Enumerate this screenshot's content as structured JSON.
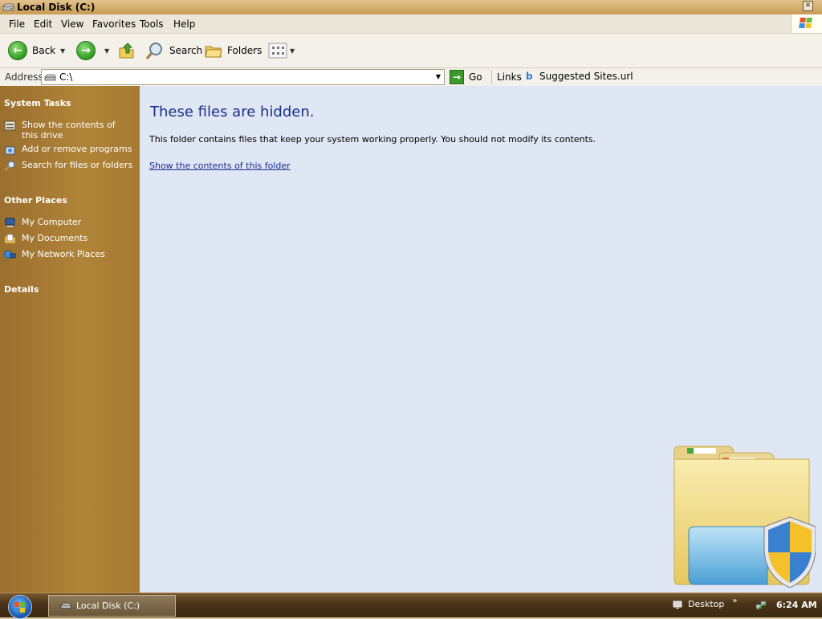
{
  "window": {
    "title": "Local Disk (C:)"
  },
  "menu": {
    "items": [
      "File",
      "Edit",
      "View",
      "Favorites",
      "Tools",
      "Help"
    ]
  },
  "toolbar": {
    "back": "Back",
    "search": "Search",
    "folders": "Folders"
  },
  "address": {
    "label": "Address",
    "value": "C:\\",
    "go": "Go",
    "links": "Links",
    "suggested": "Suggested Sites.url"
  },
  "sidebar": {
    "system_tasks": {
      "title": "System Tasks",
      "items": [
        "Show the contents of this drive",
        "Add or remove programs",
        "Search for files or folders"
      ]
    },
    "other_places": {
      "title": "Other Places",
      "items": [
        "My Computer",
        "My Documents",
        "My Network Places"
      ]
    },
    "details": {
      "title": "Details"
    }
  },
  "content": {
    "heading": "These files are hidden.",
    "description": "This folder contains files that keep your system working properly. You should not modify its contents.",
    "link": "Show the contents of this folder"
  },
  "taskbar": {
    "task": "Local Disk (C:)",
    "desktop": "Desktop",
    "time": "6:24 AM"
  },
  "colors": {
    "sidebar": "#a57a32",
    "content_bg": "#dfe6f4",
    "heading": "#1a2f87",
    "taskbar": "#3b2912"
  },
  "icons": [
    "drive-icon",
    "close-icon",
    "windows-logo-icon",
    "back-arrow-icon",
    "forward-arrow-icon",
    "up-folder-icon",
    "search-icon",
    "folders-icon",
    "views-icon",
    "go-arrow-icon",
    "bing-icon",
    "network-tray-icon",
    "start-orb-icon"
  ]
}
